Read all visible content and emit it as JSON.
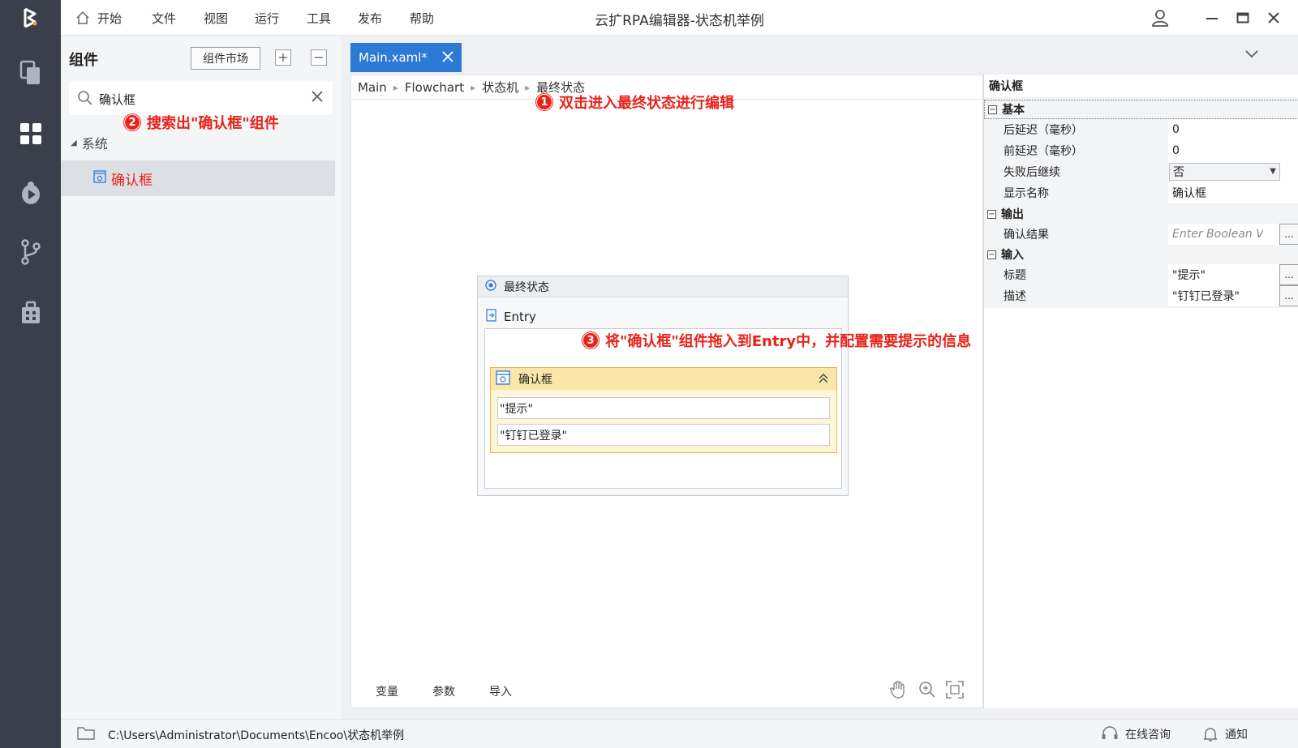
{
  "window": {
    "title": "云扩RPA编辑器-状态机举例"
  },
  "menu": {
    "items": [
      "开始",
      "文件",
      "视图",
      "运行",
      "工具",
      "发布",
      "帮助"
    ]
  },
  "rail": {
    "icons": [
      "logo-icon",
      "documents-icon",
      "components-icon",
      "debug-icon",
      "git-branch-icon",
      "package-icon"
    ]
  },
  "left_panel": {
    "title": "组件",
    "market_button": "组件市场",
    "expand_symbol": "+",
    "collapse_symbol": "−",
    "search": {
      "value": "确认框"
    },
    "annotation": {
      "num": "2",
      "text": "搜索出\"确认框\"组件"
    },
    "tree": {
      "node": "系统",
      "item": "确认框"
    }
  },
  "editor": {
    "tab": {
      "label": "Main.xaml*"
    },
    "breadcrumb": [
      "Main",
      "Flowchart",
      "状态机",
      "最终状态"
    ],
    "annotation1": {
      "num": "1",
      "text": "双击进入最终状态进行编辑"
    },
    "annotation3": {
      "num": "3",
      "text": "将\"确认框\"组件拖入到Entry中，并配置需要提示的信息"
    },
    "state": {
      "title": "最终状态",
      "entry_label": "Entry",
      "activity": {
        "title": "确认框",
        "field1": "\"提示\"",
        "field2": "\"钉钉已登录\""
      }
    },
    "bottom_tabs": [
      "变量",
      "参数",
      "导入"
    ]
  },
  "properties": {
    "title": "确认框",
    "categories": {
      "basic": "基本",
      "output": "输出",
      "input": "输入"
    },
    "category_symbol": "−",
    "ellipsis": "...",
    "rows": {
      "delay_after": {
        "name": "后延迟（毫秒）",
        "value": "0"
      },
      "delay_before": {
        "name": "前延迟（毫秒）",
        "value": "0"
      },
      "continue_on_error": {
        "name": "失败后继续",
        "value": "否"
      },
      "display_name": {
        "name": "显示名称",
        "value": "确认框"
      },
      "confirm_result": {
        "name": "确认结果",
        "placeholder": "Enter Boolean V"
      },
      "title": {
        "name": "标题",
        "value": "\"提示\""
      },
      "description": {
        "name": "描述",
        "value": "\"钉钉已登录\""
      }
    }
  },
  "status_bar": {
    "path": "C:\\Users\\Administrator\\Documents\\Encoo\\状态机举例",
    "consult": "在线咨询",
    "notify": "通知"
  },
  "colors": {
    "accent": "#2d7ad6",
    "annotation": "#e8231a",
    "rail": "#3a3f4b",
    "activity_header": "#fae6a9"
  }
}
